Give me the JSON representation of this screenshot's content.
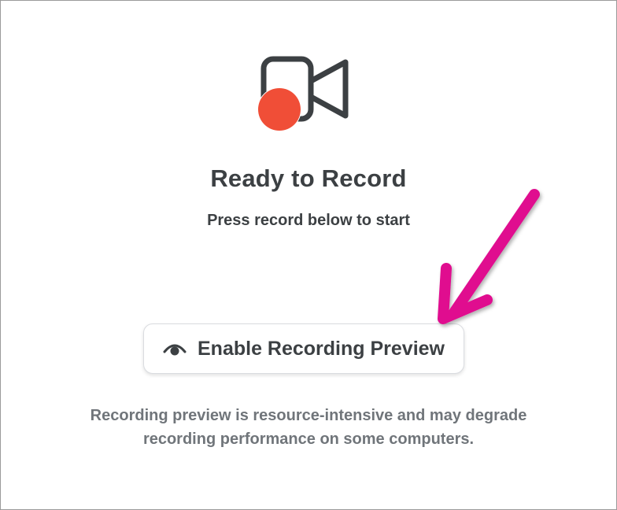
{
  "main": {
    "icon": "video-record-icon",
    "title": "Ready to Record",
    "subtitle": "Press record below to start"
  },
  "preview_button": {
    "icon": "eye-icon",
    "label": "Enable Recording Preview"
  },
  "note": {
    "line1": "Recording preview is resource-intensive and may degrade",
    "line2": "recording performance on some computers."
  },
  "annotation": {
    "type": "arrow",
    "color": "#e0118f"
  },
  "colors": {
    "record_dot": "#f04e37",
    "camera_outline": "#3c4043",
    "text_primary": "#3c4043",
    "text_secondary": "#70757a"
  }
}
